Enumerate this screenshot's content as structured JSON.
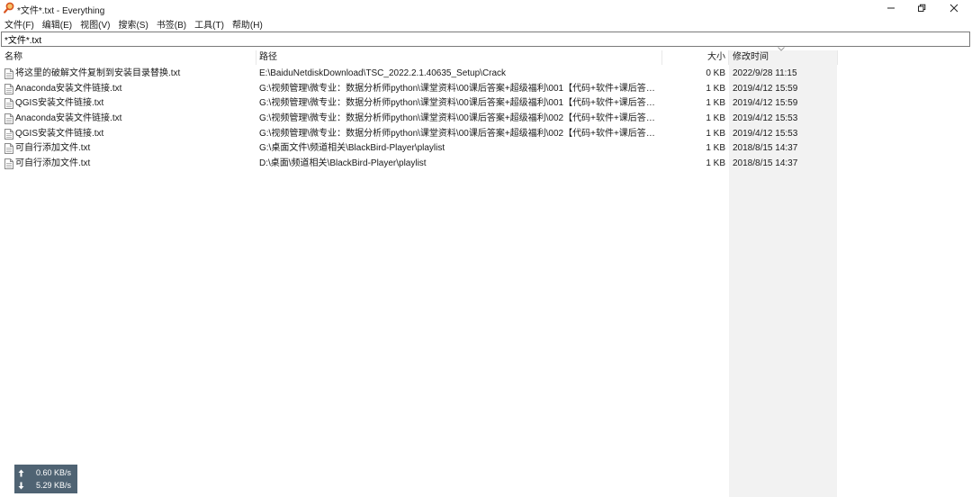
{
  "window": {
    "title": "*文件*.txt - Everything",
    "app_icon": "magnifier-icon",
    "controls": [
      "minimize-icon",
      "restore-icon",
      "close-icon"
    ]
  },
  "menu": [
    "文件(F)",
    "编辑(E)",
    "视图(V)",
    "搜索(S)",
    "书签(B)",
    "工具(T)",
    "帮助(H)"
  ],
  "search": {
    "value": "*文件*.txt"
  },
  "columns": {
    "name": "名称",
    "path": "路径",
    "size": "大小",
    "modified": "修改时间"
  },
  "sort": {
    "column": "修改时间",
    "icon": "chevron-down-icon"
  },
  "rows": [
    {
      "name": "将这里的破解文件复制到安装目录替换.txt",
      "path": "E:\\BaiduNetdiskDownload\\TSC_2022.2.1.40635_Setup\\Crack",
      "size": "0 KB",
      "modified": "2022/9/28 11:15"
    },
    {
      "name": "Anaconda安装文件链接.txt",
      "path": "G:\\视频管理\\微专业：数据分析师python\\课堂资料\\00课后答案+超级福利\\001【代码+软件+课后答案...",
      "size": "1 KB",
      "modified": "2019/4/12 15:59"
    },
    {
      "name": "QGIS安装文件链接.txt",
      "path": "G:\\视频管理\\微专业：数据分析师python\\课堂资料\\00课后答案+超级福利\\001【代码+软件+课后答案...",
      "size": "1 KB",
      "modified": "2019/4/12 15:59"
    },
    {
      "name": "Anaconda安装文件链接.txt",
      "path": "G:\\视频管理\\微专业：数据分析师python\\课堂资料\\00课后答案+超级福利\\002【代码+软件+课后答案...",
      "size": "1 KB",
      "modified": "2019/4/12 15:53"
    },
    {
      "name": "QGIS安装文件链接.txt",
      "path": "G:\\视频管理\\微专业：数据分析师python\\课堂资料\\00课后答案+超级福利\\002【代码+软件+课后答案...",
      "size": "1 KB",
      "modified": "2019/4/12 15:53"
    },
    {
      "name": "可自行添加文件.txt",
      "path": "G:\\桌面文件\\频道相关\\BlackBird-Player\\playlist",
      "size": "1 KB",
      "modified": "2018/8/15 14:37"
    },
    {
      "name": "可自行添加文件.txt",
      "path": "D:\\桌面\\频道相关\\BlackBird-Player\\playlist",
      "size": "1 KB",
      "modified": "2018/8/15 14:37"
    }
  ],
  "file_icon": "text-file-icon",
  "netspeed": {
    "upload": "0.60 KB/s",
    "download": "5.29 KB/s",
    "upload_icon": "arrow-up-icon",
    "download_icon": "arrow-down-icon"
  }
}
